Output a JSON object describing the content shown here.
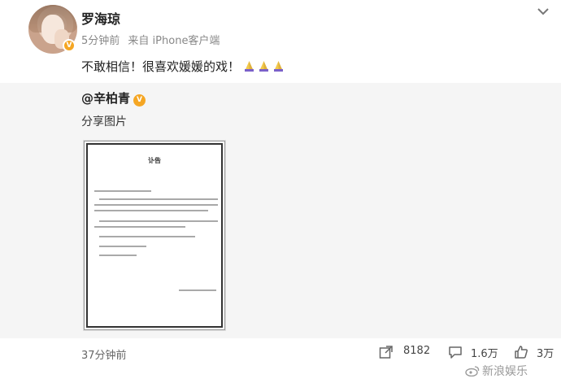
{
  "post": {
    "username": "罗海琼",
    "time": "5分钟前",
    "source": "来自 iPhone客户端",
    "text": "不敢相信！很喜欢媛媛的戏！",
    "verified_mark": "V"
  },
  "repost": {
    "username": "@辛柏青",
    "text": "分享图片",
    "image": {
      "doc_title": "讣告"
    },
    "time": "37分钟前",
    "actions": {
      "share_count": "8182",
      "comment_count": "1.6万",
      "like_count": "3万"
    }
  },
  "watermark": "新浪娱乐",
  "colors": {
    "verify_badge": "#f5a623",
    "repost_background": "#f5f5f5",
    "meta_text": "#888888"
  }
}
